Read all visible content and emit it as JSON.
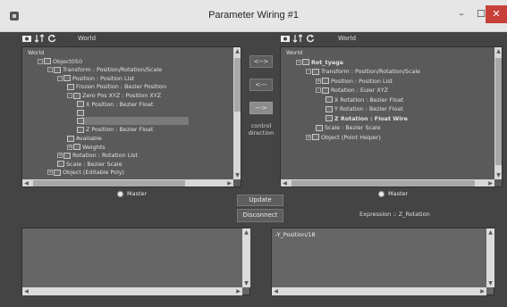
{
  "window": {
    "title": "Parameter Wiring #1",
    "minimize": "–",
    "maximize": "☐",
    "close": "✕"
  },
  "left_toolbar": {
    "world_label": "World"
  },
  "right_toolbar": {
    "world_label": "World"
  },
  "left_tree": {
    "rows": [
      {
        "label": "World",
        "depth": 0,
        "expander": ""
      },
      {
        "label": "Object050",
        "depth": 1,
        "expander": "-"
      },
      {
        "label": "Transform : Position/Rotation/Scale",
        "depth": 2,
        "expander": "-"
      },
      {
        "label": "Position : Position List",
        "depth": 3,
        "expander": "-"
      },
      {
        "label": "Frozen Position : Bezier Position",
        "depth": 4,
        "expander": ""
      },
      {
        "label": "Zero Pos XYZ : Position XYZ",
        "depth": 4,
        "expander": "-"
      },
      {
        "label": "X Position : Bezier Float",
        "depth": 5,
        "expander": ""
      },
      {
        "label": "",
        "depth": 5,
        "expander": ""
      },
      {
        "label": "",
        "depth": 5,
        "expander": ""
      },
      {
        "label": "Z Position : Bezier Float",
        "depth": 5,
        "expander": ""
      },
      {
        "label": "Available",
        "depth": 4,
        "expander": ""
      },
      {
        "label": "Weights",
        "depth": 4,
        "expander": "+"
      },
      {
        "label": "Rotation : Rotation List",
        "depth": 3,
        "expander": "+"
      },
      {
        "label": "Scale : Bezier Scale",
        "depth": 3,
        "expander": ""
      },
      {
        "label": "Object (Editable Poly)",
        "depth": 2,
        "expander": "+"
      }
    ]
  },
  "right_tree": {
    "rows": [
      {
        "label": "World",
        "depth": 0,
        "expander": ""
      },
      {
        "label": "Rot_tyaga",
        "depth": 1,
        "expander": "-"
      },
      {
        "label": "Transform : Position/Rotation/Scale",
        "depth": 2,
        "expander": "-"
      },
      {
        "label": "Position : Position List",
        "depth": 3,
        "expander": "+"
      },
      {
        "label": "Rotation : Euler XYZ",
        "depth": 3,
        "expander": "-"
      },
      {
        "label": "X Rotation : Bezier Float",
        "depth": 4,
        "expander": ""
      },
      {
        "label": "Y Rotation : Bezier Float",
        "depth": 4,
        "expander": ""
      },
      {
        "label": "Z Rotation : Float Wire",
        "depth": 4,
        "expander": ""
      },
      {
        "label": "Scale : Bezier Scale",
        "depth": 3,
        "expander": ""
      },
      {
        "label": "Object (Point Helper)",
        "depth": 2,
        "expander": "+"
      }
    ]
  },
  "middle": {
    "bidirectional": "<-->",
    "left": "<---",
    "right": "--->",
    "control_direction_line1": "control",
    "control_direction_line2": "direction"
  },
  "master_left": "Master",
  "master_right": "Master",
  "update_button": "Update",
  "disconnect_button": "Disconnect",
  "expression_label": "Expression :: Z_Rotation",
  "left_expression": "",
  "right_expression": "-Y_Position/18",
  "icons": [
    "camera-icon",
    "swap-icon",
    "refresh-icon",
    "app-icon"
  ]
}
